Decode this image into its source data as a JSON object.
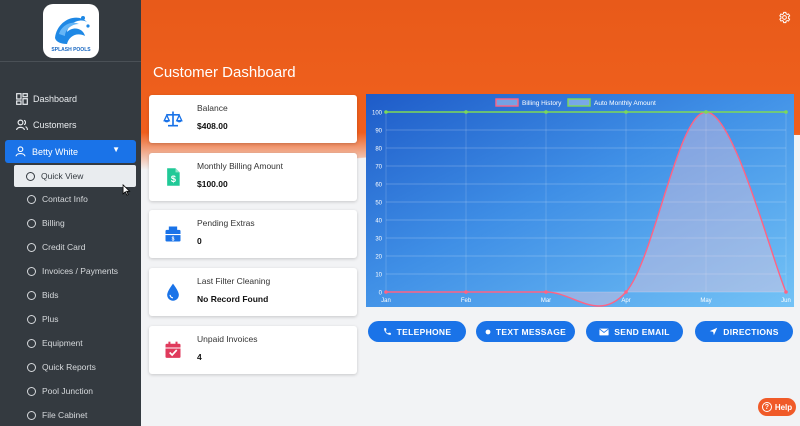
{
  "sidebar": {
    "logo_text": "SPLASH POOLS",
    "items": [
      {
        "label": "Dashboard",
        "icon": "dashboard-icon"
      },
      {
        "label": "Customers",
        "icon": "users-icon"
      }
    ],
    "active_customer": "Betty White",
    "sub_items": [
      "Quick View",
      "Contact Info",
      "Billing",
      "Credit Card",
      "Invoices / Payments",
      "Bids",
      "Plus",
      "Equipment",
      "Quick Reports",
      "Pool Junction",
      "File Cabinet"
    ],
    "current_sub": "Quick View"
  },
  "page": {
    "title": "Customer Dashboard"
  },
  "cards": [
    {
      "label": "Balance",
      "value": "$408.00",
      "icon": "scale-icon",
      "color": "#1a73e8"
    },
    {
      "label": "Monthly Billing Amount",
      "value": "$100.00",
      "icon": "invoice-dollar-icon",
      "color": "#20c997"
    },
    {
      "label": "Pending Extras",
      "value": "0",
      "icon": "cash-register-icon",
      "color": "#1a73e8"
    },
    {
      "label": "Last Filter Cleaning",
      "value": "No Record Found",
      "icon": "water-drop-icon",
      "color": "#1a73e8"
    },
    {
      "label": "Unpaid Invoices",
      "value": "4",
      "icon": "calendar-check-icon",
      "color": "#e03a5c"
    }
  ],
  "chart_data": {
    "type": "line",
    "categories": [
      "Jan",
      "Feb",
      "Mar",
      "Apr",
      "May",
      "Jun"
    ],
    "ylim": [
      0,
      100
    ],
    "yticks": [
      0,
      10,
      20,
      30,
      40,
      50,
      60,
      70,
      80,
      90,
      100
    ],
    "series": [
      {
        "name": "Billing History",
        "values": [
          0,
          0,
          0,
          0,
          100,
          0
        ],
        "color": "#ff6384"
      },
      {
        "name": "Auto Monthly Amount",
        "values": [
          100,
          100,
          100,
          100,
          100,
          100
        ],
        "color": "#7ed957"
      }
    ],
    "legend": "top-center",
    "grid": true
  },
  "actions": [
    {
      "label": "TELEPHONE",
      "icon": "phone-icon"
    },
    {
      "label": "TEXT MESSAGE",
      "icon": "dot-icon"
    },
    {
      "label": "SEND EMAIL",
      "icon": "envelope-icon"
    },
    {
      "label": "DIRECTIONS",
      "icon": "location-arrow-icon"
    }
  ],
  "help": {
    "label": "Help"
  },
  "colors": {
    "accent": "#1a73e8",
    "header": "#ee5f1c",
    "sidebar": "#343a40"
  }
}
